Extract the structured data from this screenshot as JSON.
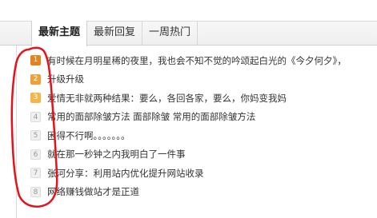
{
  "tabs": [
    {
      "label": "最新主题",
      "active": true
    },
    {
      "label": "最新回复",
      "active": false
    },
    {
      "label": "一周热门",
      "active": false
    }
  ],
  "topics": [
    {
      "rank": "1",
      "title": "有时候在月明星稀的夜里，我也会不知不觉的吟颂起白光的《今夕何夕》，"
    },
    {
      "rank": "2",
      "title": "升级升级"
    },
    {
      "rank": "3",
      "title": "爱情无非就两种结果：要么，各回各家，要么，你妈变我妈"
    },
    {
      "rank": "4",
      "title": "常用的面部除皱方法 面部除皱 常用的面部除皱方法"
    },
    {
      "rank": "5",
      "title": "困得不行啊。。。。。。。"
    },
    {
      "rank": "6",
      "title": "就在那一秒钟之内我明白了一件事"
    },
    {
      "rank": "7",
      "title": "张河分享：利用站内优化提升网站收录"
    },
    {
      "rank": "8",
      "title": "网络赚钱做站才是正道"
    }
  ],
  "colors": {
    "hot1": "#e9821e",
    "hot2": "#f0a03a",
    "hot3": "#f3b64a",
    "annotation": "#e3121b"
  }
}
